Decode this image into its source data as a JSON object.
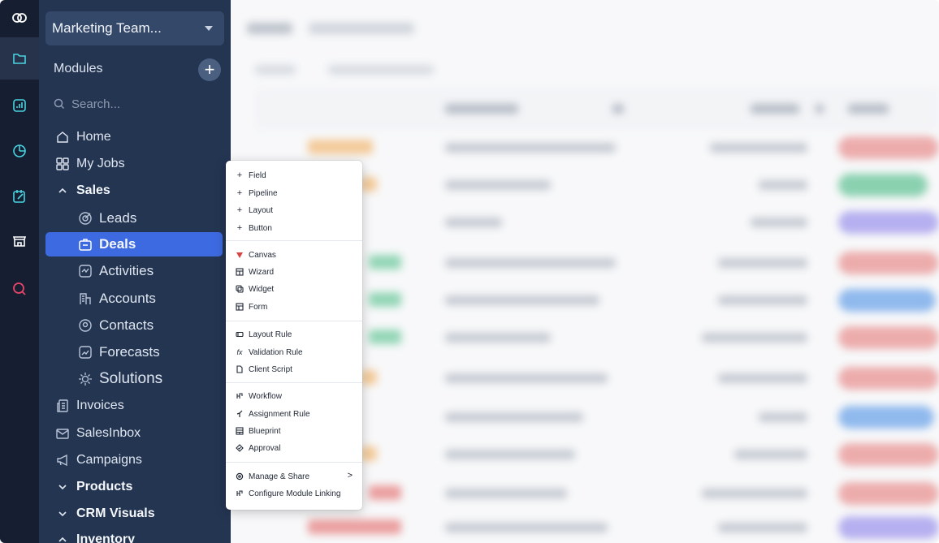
{
  "rail": {
    "icons": [
      "logo-icon",
      "modules-icon",
      "analytics-icon",
      "clock-icon",
      "tasks-icon",
      "store-icon",
      "search-app-icon"
    ]
  },
  "sidebar": {
    "team_name": "Marketing Team...",
    "modules_label": "Modules",
    "add_label": "+",
    "search_placeholder": "Search...",
    "items": [
      {
        "label": "Home",
        "icon": "home-icon"
      },
      {
        "label": "My Jobs",
        "icon": "grid-icon"
      },
      {
        "label": "Sales",
        "icon": "chevron-up-icon"
      },
      {
        "label": "Leads",
        "icon": "target-icon"
      },
      {
        "label": "Deals",
        "icon": "deals-icon"
      },
      {
        "label": "Activities",
        "icon": "activities-icon"
      },
      {
        "label": "Accounts",
        "icon": "building-icon"
      },
      {
        "label": "Contacts",
        "icon": "contact-icon"
      },
      {
        "label": "Forecasts",
        "icon": "forecast-icon"
      },
      {
        "label": "Solutions",
        "icon": "bulb-icon"
      },
      {
        "label": "Invoices",
        "icon": "invoice-icon"
      },
      {
        "label": "SalesInbox",
        "icon": "inbox-icon"
      },
      {
        "label": "Campaigns",
        "icon": "megaphone-icon"
      },
      {
        "label": "Products",
        "icon": "chevron-down-icon"
      },
      {
        "label": "CRM Visuals",
        "icon": "chevron-down-icon"
      },
      {
        "label": "Inventory",
        "icon": "chevron-up-icon"
      }
    ]
  },
  "menu": {
    "group1": [
      "Field",
      "Pipeline",
      "Layout",
      "Button"
    ],
    "group2": [
      "Canvas",
      "Wizard",
      "Widget",
      "Form"
    ],
    "group3": [
      "Layout Rule",
      "Validation Rule",
      "Client Script"
    ],
    "group4": [
      "Workflow",
      "Assignment Rule",
      "Blueprint",
      "Approval"
    ],
    "group5": [
      "Manage & Share",
      "Configure Module Linking"
    ],
    "submenu_arrow": ">"
  },
  "colors": {
    "sidebar_bg": "#243552",
    "rail_bg": "#161f31",
    "active_item": "#3d6ae0",
    "canvas_icon": "#d64545"
  }
}
